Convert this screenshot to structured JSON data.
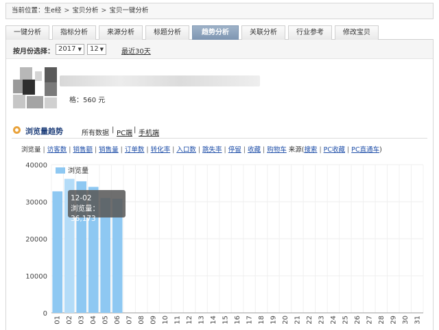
{
  "breadcrumb": {
    "prefix": "当前位置：",
    "items": [
      "生e经",
      "宝贝分析",
      "宝贝一键分析"
    ],
    "sep": ">"
  },
  "tabs": [
    {
      "label": "一键分析",
      "active": false
    },
    {
      "label": "指标分析",
      "active": false
    },
    {
      "label": "来源分析",
      "active": false
    },
    {
      "label": "标题分析",
      "active": false
    },
    {
      "label": "趋势分析",
      "active": true
    },
    {
      "label": "关联分析",
      "active": false
    },
    {
      "label": "行业参考",
      "active": false
    },
    {
      "label": "修改宝贝",
      "active": false
    }
  ],
  "month_bar": {
    "label": "按月份选择：",
    "year": "2017",
    "month": "12",
    "recent": "最近30天"
  },
  "product": {
    "price": "格：560 元"
  },
  "trend": {
    "title": "浏览量趋势",
    "sources": [
      "所有数据",
      "PC端",
      "手机端"
    ]
  },
  "metrics": {
    "items": [
      "浏览量",
      "访客数",
      "销售额",
      "销售量",
      "订单数",
      "转化率",
      "入口数",
      "跳失率",
      "停留",
      "收藏",
      "购物车"
    ],
    "source_label": "来源(",
    "source_items": [
      "搜索",
      "PC收藏",
      "PC直通车"
    ],
    "source_close": ")"
  },
  "chart_data": {
    "type": "bar",
    "legend": "浏览量",
    "categories": [
      "01",
      "02",
      "03",
      "04",
      "05",
      "06",
      "07",
      "08",
      "09",
      "10",
      "11",
      "12",
      "13",
      "14",
      "15",
      "16",
      "17",
      "18",
      "19",
      "20",
      "21",
      "22",
      "23",
      "24",
      "25",
      "26",
      "27",
      "28",
      "29",
      "30",
      "31"
    ],
    "values": [
      32800,
      36173,
      35500,
      34000,
      31000,
      30800,
      null,
      null,
      null,
      null,
      null,
      null,
      null,
      null,
      null,
      null,
      null,
      null,
      null,
      null,
      null,
      null,
      null,
      null,
      null,
      null,
      null,
      null,
      null,
      null,
      null
    ],
    "ylim": [
      0,
      40000
    ],
    "yticks": [
      0,
      10000,
      20000,
      30000,
      40000
    ],
    "highlight_index": 1,
    "bar_color": "#8ec8f2",
    "highlight_color": "#b4dcf8"
  },
  "tooltip": {
    "date": "12-02",
    "text": "浏览量：36,173"
  }
}
